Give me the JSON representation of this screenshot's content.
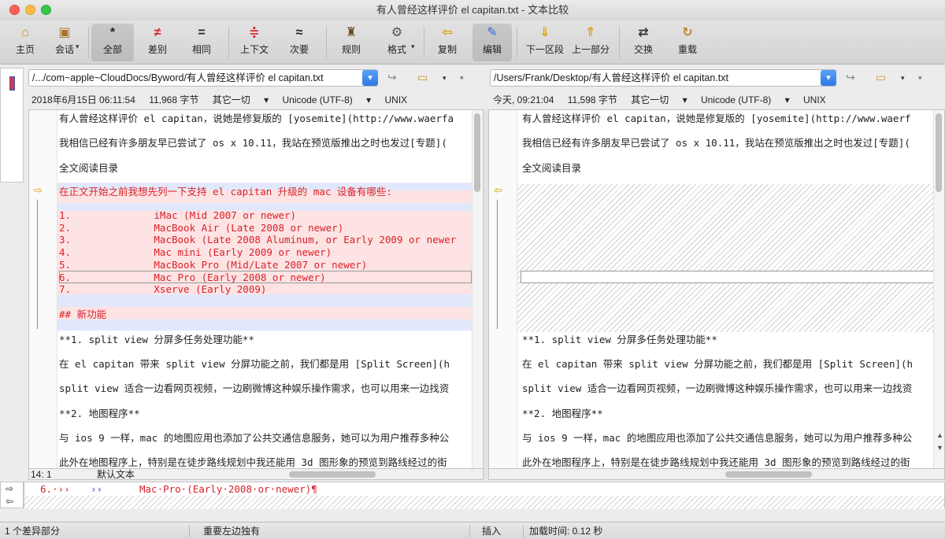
{
  "window": {
    "title": "有人曾经这样评价 el capitan.txt - 文本比较"
  },
  "toolbar": {
    "home": "主页",
    "session": "会话",
    "all": "全部",
    "diffs": "差别",
    "same": "相同",
    "context": "上下文",
    "minor": "次要",
    "rules": "规则",
    "format": "格式",
    "copy": "复制",
    "edit": "编辑",
    "next_section": "下一区段",
    "prev_part": "上一部分",
    "swap": "交换",
    "reload": "重载"
  },
  "left": {
    "path": "/.../com~apple~CloudDocs/Byword/有人曾经这样评价 el capitan.txt",
    "date": "2018年6月15日 06:11:54",
    "size": "11,968 字节",
    "mode": "其它一切",
    "encoding": "Unicode (UTF-8)",
    "lineending": "UNIX",
    "lines": {
      "l1": "有人曾经这样评价 el capitan，说她是修复版的 [yosemite](http://www.waerfa",
      "l2": "我相信已经有许多朋友早已尝试了 os x 10.11，我站在预览版推出之时也发过[专题](",
      "l3": "全文阅读目录",
      "l4": "在正文开始之前我想先列一下支持 el capitan 升级的 mac 设备有哪些:",
      "l5": "1.              iMac (Mid 2007 or newer)",
      "l6": "2.              MacBook Air (Late 2008 or newer)",
      "l7": "3.              MacBook (Late 2008 Aluminum, or Early 2009 or newer",
      "l8": "4.              Mac mini (Early 2009 or newer)",
      "l9": "5.              MacBook Pro (Mid/Late 2007 or newer)",
      "l10": "6.              Mac Pro (Early 2008 or newer)",
      "l11": "7.              Xserve (Early 2009)",
      "l12": "## 新功能",
      "l13": "**1. split view 分屏多任务处理功能**",
      "l14": "在 el capitan 带来 split view 分屏功能之前，我们都是用 [Split Screen](h",
      "l15": "split view 适合一边看网页视频，一边刷微博这种娱乐操作需求，也可以用来一边找资",
      "l16": "**2. 地图程序**",
      "l17": "与 ios 9 一样，mac 的地图应用也添加了公共交通信息服务，她可以为用户推荐多种公",
      "l18": "此外在地图程序上，特别是在徒步路线规划中我还能用 3d 图形象的预览到路线经过的街"
    },
    "position": "14: 1",
    "textmode": "默认文本"
  },
  "right": {
    "path": "/Users/Frank/Desktop/有人曾经这样评价 el capitan.txt",
    "date": "今天, 09:21:04",
    "size": "11,598 字节",
    "mode": "其它一切",
    "encoding": "Unicode (UTF-8)",
    "lineending": "UNIX",
    "lines": {
      "l1": "有人曾经这样评价 el capitan，说她是修复版的 [yosemite](http://www.waerf",
      "l2": "我相信已经有许多朋友早已尝试了 os x 10.11，我站在预览版推出之时也发过[专题](",
      "l3": "全文阅读目录",
      "l13": "**1. split view 分屏多任务处理功能**",
      "l14": "在 el capitan 带来 split view 分屏功能之前，我们都是用 [Split Screen](h",
      "l15": "split view 适合一边看网页视频，一边刷微博这种娱乐操作需求，也可以用来一边找资",
      "l16": "**2. 地图程序**",
      "l17": "与 ios 9 一样，mac 的地图应用也添加了公共交通信息服务，她可以为用户推荐多种公",
      "l18": "此外在地图程序上，特别是在徒步路线规划中我还能用 3d 图形象的预览到路线经过的街"
    }
  },
  "detail": {
    "prefix": "6.·››",
    "arrows": "››",
    "text": "Mac·Pro·(Early·2008·or·newer)¶"
  },
  "status": {
    "diffcount": "1 个差异部分",
    "note": "重要左边独有",
    "mode": "插入",
    "loadtime": "加载时间: 0.12 秒"
  }
}
